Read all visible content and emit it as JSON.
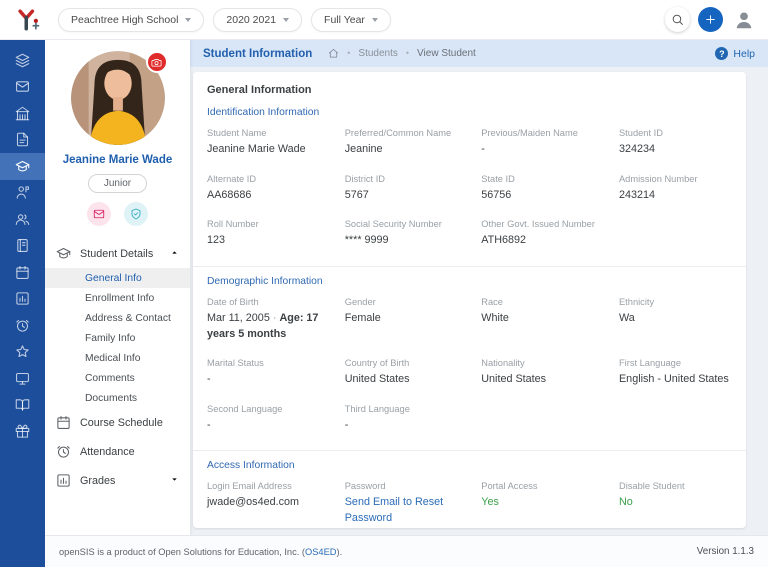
{
  "header": {
    "school_selector": "Peachtree High School",
    "year_selector": "2020 2021",
    "term_selector": "Full Year"
  },
  "icon_rail": {
    "items": [
      {
        "icon": "layers",
        "active": false
      },
      {
        "icon": "mail",
        "active": false
      },
      {
        "icon": "school",
        "active": false
      },
      {
        "icon": "document",
        "active": false
      },
      {
        "icon": "graduation-cap",
        "active": true
      },
      {
        "icon": "staff",
        "active": false
      },
      {
        "icon": "users",
        "active": false
      },
      {
        "icon": "notebook",
        "active": false
      },
      {
        "icon": "calendar",
        "active": false
      },
      {
        "icon": "chart",
        "active": false
      },
      {
        "icon": "clock",
        "active": false
      },
      {
        "icon": "star",
        "active": false
      },
      {
        "icon": "monitor",
        "active": false
      },
      {
        "icon": "open-book",
        "active": false
      },
      {
        "icon": "gift",
        "active": false
      }
    ]
  },
  "profile": {
    "name": "Jeanine Marie Wade",
    "grade_badge": "Junior"
  },
  "nav": {
    "sections": [
      {
        "label": "Student Details",
        "icon": "graduation-cap",
        "expandable": true,
        "expanded": true,
        "children": [
          {
            "label": "General Info",
            "active": true
          },
          {
            "label": "Enrollment Info",
            "active": false
          },
          {
            "label": "Address & Contact",
            "active": false
          },
          {
            "label": "Family Info",
            "active": false
          },
          {
            "label": "Medical Info",
            "active": false
          },
          {
            "label": "Comments",
            "active": false
          },
          {
            "label": "Documents",
            "active": false
          }
        ]
      },
      {
        "label": "Course Schedule",
        "icon": "calendar"
      },
      {
        "label": "Attendance",
        "icon": "clock"
      },
      {
        "label": "Grades",
        "icon": "chart",
        "expandable": true,
        "expanded": false
      }
    ]
  },
  "breadcrumb": {
    "title": "Student Information",
    "items": [
      "Students",
      "View Student"
    ],
    "help_label": "Help"
  },
  "card": {
    "title": "General Information",
    "sections": [
      {
        "title": "Identification Information",
        "fields": [
          {
            "label": "Student Name",
            "value": "Jeanine Marie Wade"
          },
          {
            "label": "Preferred/Common Name",
            "value": "Jeanine"
          },
          {
            "label": "Previous/Maiden Name",
            "value": "-"
          },
          {
            "label": "Student ID",
            "value": "324234"
          },
          {
            "label": "Alternate ID",
            "value": "AA68686"
          },
          {
            "label": "District ID",
            "value": "5767"
          },
          {
            "label": "State ID",
            "value": "56756"
          },
          {
            "label": "Admission Number",
            "value": "243214"
          },
          {
            "label": "Roll Number",
            "value": "123"
          },
          {
            "label": "Social Security Number",
            "value": "**** 9999"
          },
          {
            "label": "Other Govt. Issued Number",
            "value": "ATH6892"
          }
        ]
      },
      {
        "title": "Demographic Information",
        "fields": [
          {
            "label": "Date of Birth",
            "value": "Mar 11, 2005",
            "suffix": "Age: 17 years 5 months"
          },
          {
            "label": "Gender",
            "value": "Female"
          },
          {
            "label": "Race",
            "value": "White"
          },
          {
            "label": "Ethnicity",
            "value": "Wa"
          },
          {
            "label": "Marital Status",
            "value": "-"
          },
          {
            "label": "Country of Birth",
            "value": "United States"
          },
          {
            "label": "Nationality",
            "value": "United States"
          },
          {
            "label": "First Language",
            "value": "English - United States"
          },
          {
            "label": "Second Language",
            "value": "-"
          },
          {
            "label": "Third Language",
            "value": "-"
          }
        ]
      },
      {
        "title": "Access Information",
        "fields": [
          {
            "label": "Login Email Address",
            "value": "jwade@os4ed.com"
          },
          {
            "label": "Password",
            "value": "Send Email to Reset Password",
            "type": "link"
          },
          {
            "label": "Portal Access",
            "value": "Yes",
            "type": "positive"
          },
          {
            "label": "Disable Student",
            "value": "No",
            "type": "positive"
          }
        ]
      }
    ]
  },
  "footer": {
    "text_before": "openSIS is a product of Open Solutions for Education, Inc. (",
    "link_label": "OS4ED",
    "text_after": ").",
    "version": "Version 1.1.3"
  },
  "colors": {
    "sidebar_blue": "#1d4e9b",
    "sidebar_active_blue": "#4472b8",
    "accent_blue": "#2260ae",
    "link_blue": "#2b6cb8",
    "positive_green": "#3da04b",
    "badge_red": "#e02b2b",
    "breadcrumb_bg": "#d9e6f7"
  }
}
